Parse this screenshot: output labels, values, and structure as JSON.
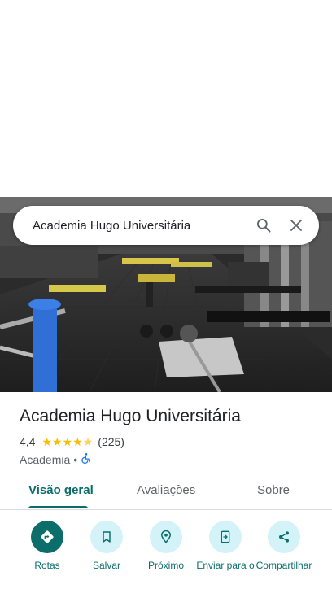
{
  "search": {
    "value": "Academia Hugo Universitária"
  },
  "place": {
    "title": "Academia Hugo Universitária",
    "rating": "4,4",
    "rating_value": 4.4,
    "review_count": "(225)",
    "category": "Academia",
    "separator": "•"
  },
  "tabs": [
    {
      "label": "Visão geral",
      "active": true
    },
    {
      "label": "Avaliações",
      "active": false
    },
    {
      "label": "Sobre",
      "active": false
    }
  ],
  "actions": [
    {
      "label": "Rotas",
      "icon": "directions-icon"
    },
    {
      "label": "Salvar",
      "icon": "bookmark-icon"
    },
    {
      "label": "Próximo",
      "icon": "nearby-icon"
    },
    {
      "label": "Enviar para o",
      "icon": "send-to-phone-icon"
    },
    {
      "label": "Compartilhar",
      "icon": "share-icon"
    }
  ],
  "colors": {
    "accent": "#0b6e6a",
    "accent_light": "#d3f3f8",
    "star": "#fbbc04"
  }
}
